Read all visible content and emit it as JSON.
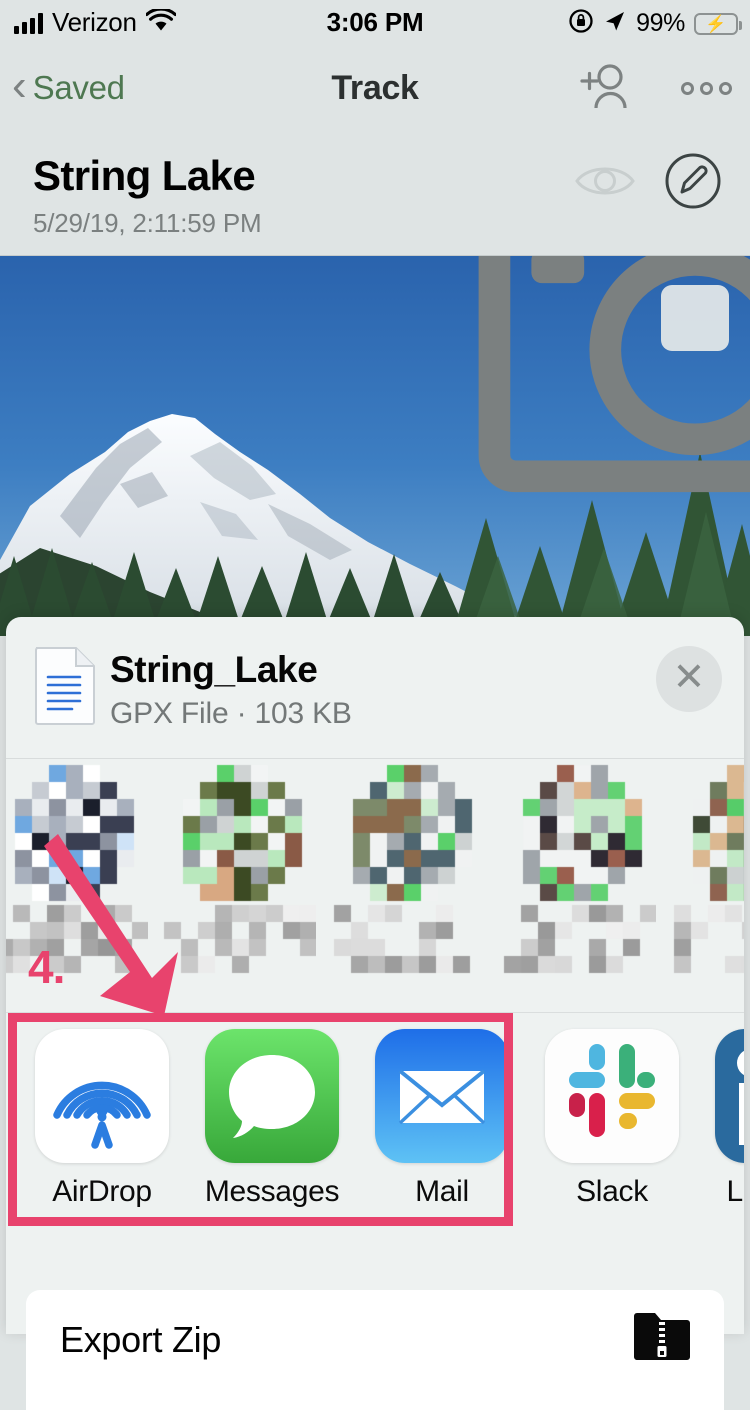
{
  "status_bar": {
    "carrier": "Verizon",
    "signal_icon": "cellular-bars-icon",
    "wifi_icon": "wifi-icon",
    "time": "3:06 PM",
    "rotation_lock_icon": "rotation-lock-icon",
    "location_icon": "location-arrow-icon",
    "battery_percent": "99%",
    "battery_icon": "battery-charging-icon",
    "battery_color": "#4cd763"
  },
  "nav_bar": {
    "back_label": "Saved",
    "back_icon": "chevron-left-icon",
    "back_tint": "#4e7851",
    "title": "Track",
    "add_user_icon": "add-person-icon",
    "more_icon": "more-circles-icon"
  },
  "track_header": {
    "name": "String Lake",
    "date": "5/29/19, 2:11:59 PM",
    "visibility_icon": "eye-icon",
    "edit_icon": "pencil-circle-icon"
  },
  "photo": {
    "camera_button_icon": "camera-icon",
    "sky_color": "#2f6eb4",
    "snow_color": "#f2f5f8",
    "tree_color": "#2f4a30"
  },
  "share_sheet": {
    "file_icon": "document-icon",
    "file_name": "String_Lake",
    "file_meta": "GPX File · 103 KB",
    "close_icon": "close-icon",
    "contacts": [
      {
        "name": "contact-avatar-1"
      },
      {
        "name": "contact-avatar-2"
      },
      {
        "name": "contact-avatar-3"
      },
      {
        "name": "contact-avatar-4"
      },
      {
        "name": "contact-avatar-5"
      }
    ],
    "apps": [
      {
        "label": "AirDrop",
        "icon": "airdrop-icon",
        "color": "#ffffff"
      },
      {
        "label": "Messages",
        "icon": "messages-icon",
        "color": "#5bd95b"
      },
      {
        "label": "Mail",
        "icon": "mail-icon",
        "color": "#2a7ef0"
      },
      {
        "label": "Slack",
        "icon": "slack-icon",
        "color": "#ffffff"
      },
      {
        "label": "LinkedIn",
        "icon": "linkedin-icon",
        "color": "#2a6a9e"
      }
    ],
    "action_rows": [
      {
        "label": "Export Zip",
        "icon": "zip-folder-icon"
      }
    ]
  },
  "annotations": {
    "step_number": "4.",
    "accent_color": "#e8436d",
    "arrow_icon": "pointer-arrow-icon",
    "highlight_box": "app-row-highlight"
  }
}
